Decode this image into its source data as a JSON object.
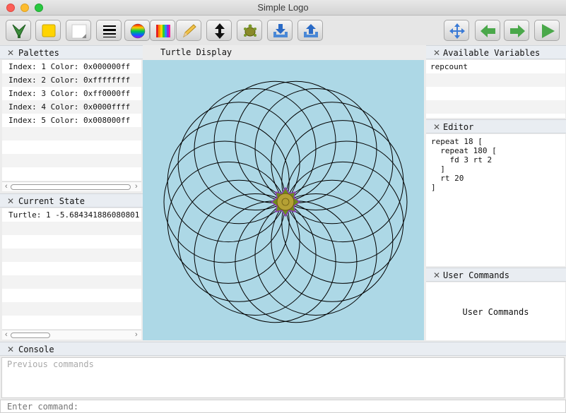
{
  "window": {
    "title": "Simple Logo"
  },
  "toolbar": {
    "left_buttons": [
      "turtle-pen-icon",
      "fill-color-icon",
      "background-color-icon",
      "line-style-icon",
      "color-wheel-icon",
      "palette-icon",
      "pencil-icon",
      "pen-up-down-icon",
      "turtle-image-icon",
      "download-icon",
      "upload-icon"
    ],
    "right_buttons": [
      "move-icon",
      "undo-icon",
      "redo-icon",
      "run-icon"
    ]
  },
  "palettes": {
    "title": "Palettes",
    "rows": [
      "Index: 1 Color: 0x000000ff",
      "Index: 2 Color: 0xffffffff",
      "Index: 3 Color: 0xff0000ff",
      "Index: 4 Color: 0x0000ffff",
      "Index: 5 Color: 0x008000ff"
    ]
  },
  "current_state": {
    "title": "Current State",
    "rows": [
      "Turtle: 1 -5.684341886080801"
    ]
  },
  "turtle_display": {
    "title": "Turtle Display",
    "background": "#add8e6",
    "circles": 18,
    "circle_radius": 86,
    "rotation_step_deg": 20
  },
  "variables": {
    "title": "Available Variables",
    "rows": [
      "repcount"
    ]
  },
  "editor": {
    "title": "Editor",
    "code": "repeat 18 [\n  repeat 180 [\n    fd 3 rt 2\n  ]\n  rt 20\n]"
  },
  "user_commands": {
    "title": "User Commands",
    "label": "User Commands"
  },
  "console": {
    "title": "Console",
    "history_placeholder": "Previous commands",
    "input_placeholder": "Enter command:"
  },
  "colors": {
    "canvas": "#add8e6",
    "header": "#e9edf2"
  }
}
